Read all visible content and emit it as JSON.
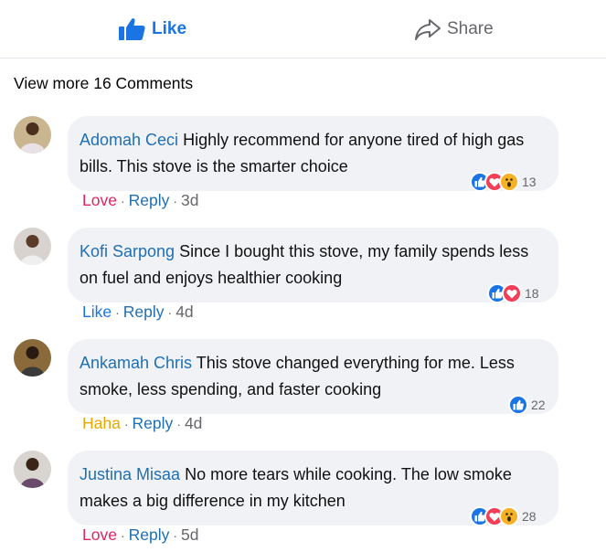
{
  "actions": {
    "like_label": "Like",
    "share_label": "Share"
  },
  "view_more": "View more 16 Comments",
  "comments": [
    {
      "author": "Adomah Ceci",
      "text": "Highly recommend for anyone tired of high gas bills. This stove is the smarter choice",
      "reaction_label": "Love",
      "reply_label": "Reply",
      "time": "3d",
      "reaction_count": "13",
      "reaction_icons": [
        "like-icon",
        "love-icon",
        "wow-icon"
      ]
    },
    {
      "author": "Kofi Sarpong",
      "text": "Since I bought this stove, my family spends less on fuel and enjoys healthier cooking",
      "reaction_label": "Like",
      "reply_label": "Reply",
      "time": "4d",
      "reaction_count": "18",
      "reaction_icons": [
        "like-icon",
        "love-icon"
      ]
    },
    {
      "author": "Ankamah Chris",
      "text": "This stove changed everything for me. Less smoke, less spending, and faster cooking",
      "reaction_label": "Haha",
      "reply_label": "Reply",
      "time": "4d",
      "reaction_count": "22",
      "reaction_icons": [
        "like-icon"
      ]
    },
    {
      "author": "Justina Misaa",
      "text": "No more tears while cooking. The low smoke makes a big difference in my kitchen",
      "reaction_label": "Love",
      "reply_label": "Reply",
      "time": "5d",
      "reaction_count": "28",
      "reaction_icons": [
        "like-icon",
        "love-icon",
        "wow-icon"
      ]
    }
  ],
  "separator": "·",
  "colors": {
    "link_blue": "#1f6fb3",
    "like_blue": "#1b74e4",
    "love_red": "#e0245e",
    "haha_yellow": "#e9a800",
    "bubble_bg": "#f0f2f5"
  }
}
